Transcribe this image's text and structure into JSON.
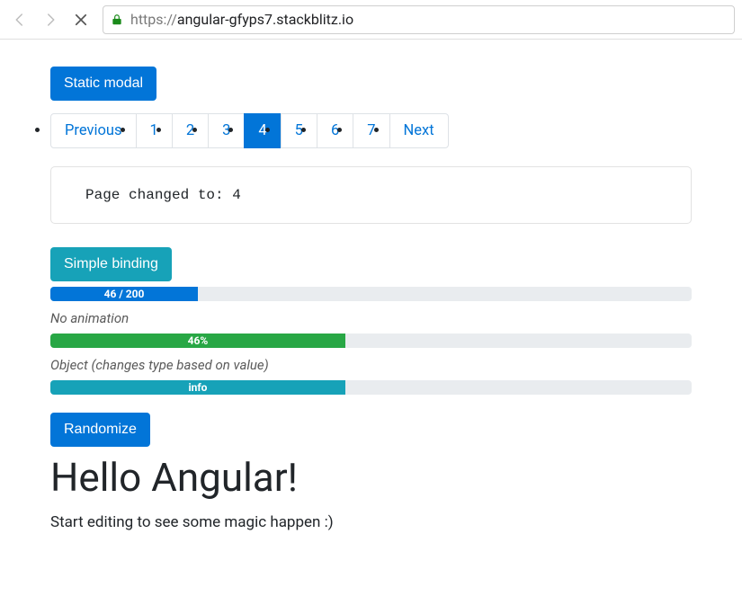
{
  "browser": {
    "url_scheme": "https://",
    "url_rest": "angular-gfyps7.stackblitz.io"
  },
  "buttons": {
    "static_modal": "Static modal",
    "simple_binding": "Simple binding",
    "randomize": "Randomize"
  },
  "pagination": {
    "prev": "Previous",
    "next": "Next",
    "pages": [
      "1",
      "2",
      "3",
      "4",
      "5",
      "6",
      "7"
    ],
    "active_index": 3
  },
  "status": {
    "text": "Page changed to: 4"
  },
  "progress": {
    "bar1": {
      "label": "46 / 200",
      "percent": 23
    },
    "caption1": "No animation",
    "bar2": {
      "label": "46%",
      "percent": 46
    },
    "caption2": "Object (changes type based on value)",
    "bar3": {
      "label": "info",
      "percent": 46
    }
  },
  "headline": "Hello Angular!",
  "subtext": "Start editing to see some magic happen :)"
}
